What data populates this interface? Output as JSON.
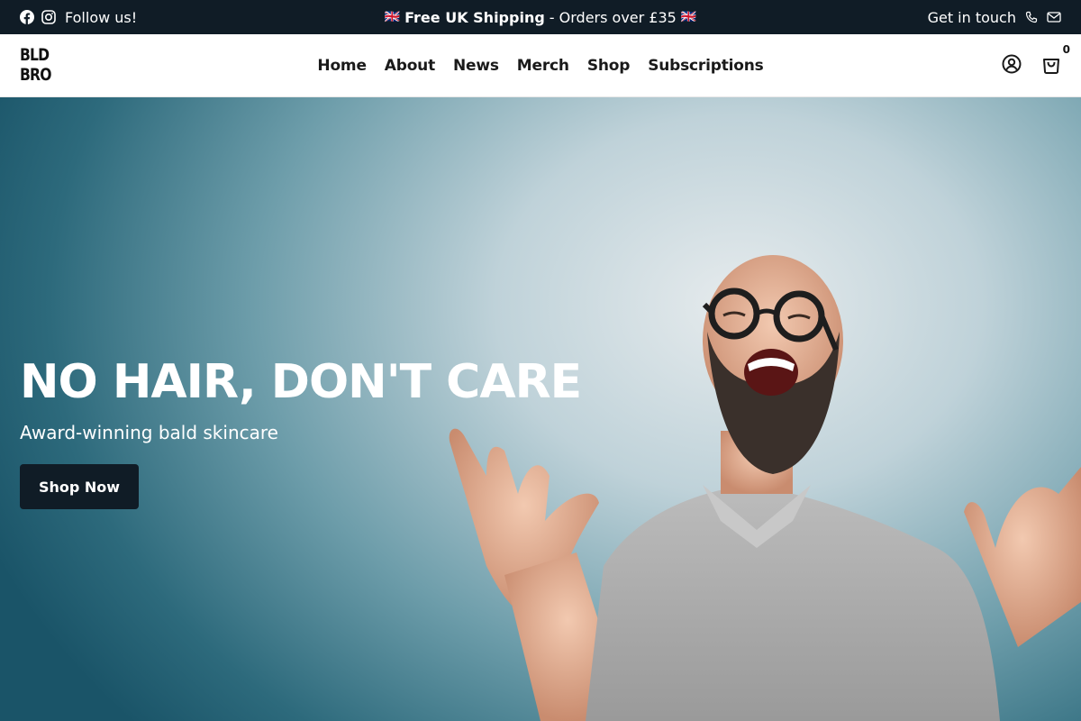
{
  "topbar": {
    "follow_label": "Follow us!",
    "flag_left": "🇬🇧",
    "promo_bold": "Free UK Shipping",
    "promo_rest": "- Orders over £35",
    "flag_right": "🇬🇧",
    "contact_label": "Get in touch",
    "icons": [
      "facebook-icon",
      "instagram-icon",
      "phone-icon",
      "mail-icon"
    ]
  },
  "header": {
    "logo_line1": "BLD",
    "logo_line2": "BRO",
    "nav": [
      "Home",
      "About",
      "News",
      "Merch",
      "Shop",
      "Subscriptions"
    ],
    "cart_count": "0",
    "icons": [
      "account-icon",
      "cart-icon"
    ]
  },
  "hero": {
    "title": "NO HAIR, DON'T CARE",
    "subtitle": "Award-winning bald skincare",
    "cta_label": "Shop Now"
  },
  "colors": {
    "topbar_bg": "#101c26",
    "button_bg": "#101c26",
    "hero_bg_light": "#e6ebed",
    "hero_bg_dark": "#1a5468"
  }
}
